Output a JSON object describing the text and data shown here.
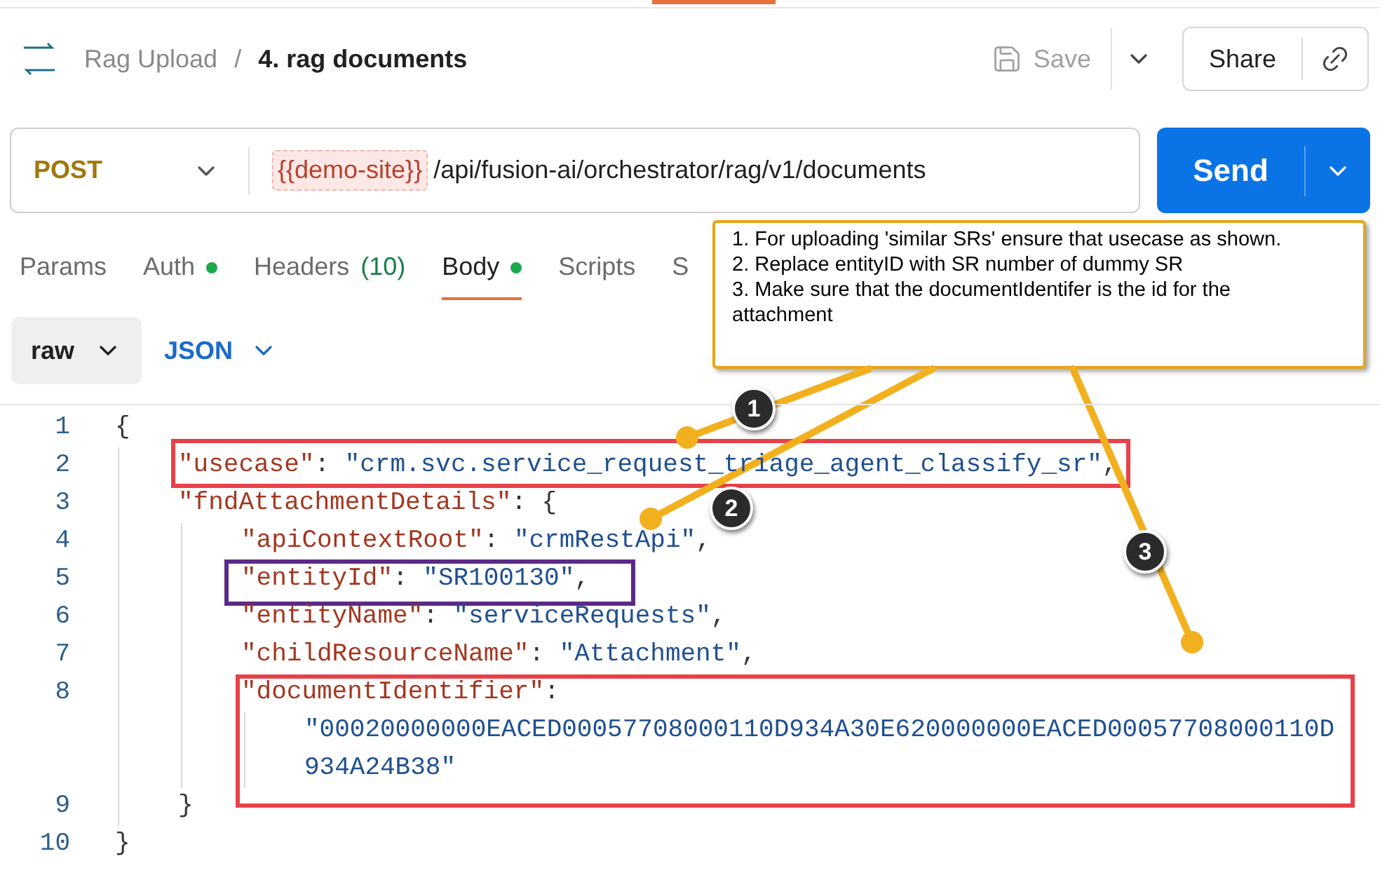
{
  "breadcrumb": {
    "collection": "Rag Upload",
    "separator": "/",
    "request": "4. rag documents"
  },
  "header_actions": {
    "save": "Save",
    "share": "Share"
  },
  "request": {
    "method": "POST",
    "url_variable": "{{demo-site}}",
    "url_path": "/api/fusion-ai/orchestrator/rag/v1/documents",
    "send": "Send"
  },
  "tabs": [
    {
      "label": "Params",
      "dot": false,
      "selected": false
    },
    {
      "label": "Auth",
      "dot": true,
      "selected": false
    },
    {
      "label": "Headers",
      "count": "(10)",
      "dot": false,
      "selected": false
    },
    {
      "label": "Body",
      "dot": true,
      "selected": true
    },
    {
      "label": "Scripts",
      "dot": false,
      "selected": false
    },
    {
      "label": "S",
      "dot": false,
      "selected": false
    }
  ],
  "body_mode": {
    "type": "raw",
    "format": "JSON"
  },
  "code_lines": [
    {
      "number": "1",
      "tokens": [
        {
          "kind": "punct",
          "text": "{"
        }
      ],
      "children": [
        {
          "number": "2",
          "tokens": [
            {
              "kind": "key",
              "text": "\"usecase\""
            },
            {
              "kind": "punct",
              "text": ": "
            },
            {
              "kind": "string",
              "text": "\"crm.svc.service_request_triage_agent_classify_sr\""
            },
            {
              "kind": "punct",
              "text": ","
            }
          ]
        },
        {
          "number": "3",
          "tokens": [
            {
              "kind": "key",
              "text": "\"fndAttachmentDetails\""
            },
            {
              "kind": "punct",
              "text": ": {"
            }
          ],
          "children": [
            {
              "number": "4",
              "tokens": [
                {
                  "kind": "key",
                  "text": "\"apiContextRoot\""
                },
                {
                  "kind": "punct",
                  "text": ": "
                },
                {
                  "kind": "string",
                  "text": "\"crmRestApi\""
                },
                {
                  "kind": "punct",
                  "text": ","
                }
              ]
            },
            {
              "number": "5",
              "tokens": [
                {
                  "kind": "key",
                  "text": "\"entityId\""
                },
                {
                  "kind": "punct",
                  "text": ": "
                },
                {
                  "kind": "string",
                  "text": "\"SR100130\""
                },
                {
                  "kind": "punct",
                  "text": ","
                }
              ]
            },
            {
              "number": "6",
              "tokens": [
                {
                  "kind": "key",
                  "text": "\"entityName\""
                },
                {
                  "kind": "punct",
                  "text": ": "
                },
                {
                  "kind": "string",
                  "text": "\"serviceRequests\""
                },
                {
                  "kind": "punct",
                  "text": ","
                }
              ]
            },
            {
              "number": "7",
              "tokens": [
                {
                  "kind": "key",
                  "text": "\"childResourceName\""
                },
                {
                  "kind": "punct",
                  "text": ": "
                },
                {
                  "kind": "string",
                  "text": "\"Attachment\""
                },
                {
                  "kind": "punct",
                  "text": ","
                }
              ]
            },
            {
              "number": "8",
              "tokens": [
                {
                  "kind": "key",
                  "text": "\"documentIdentifier\""
                },
                {
                  "kind": "punct",
                  "text": ":"
                }
              ],
              "children": [
                {
                  "tokens": [
                    {
                      "kind": "string",
                      "text": "\"00020000000EACED00057708000110D934A30E620000000EACED00057708000110D"
                    }
                  ]
                },
                {
                  "tokens": [
                    {
                      "kind": "string",
                      "text": "934A24B38\""
                    }
                  ]
                }
              ]
            }
          ]
        },
        {
          "number": "9",
          "tokens": [
            {
              "kind": "punct",
              "text": "}"
            }
          ]
        }
      ]
    },
    {
      "number": "10",
      "tokens": [
        {
          "kind": "punct",
          "text": "}"
        }
      ]
    }
  ],
  "annotations": {
    "callout": [
      "1. For uploading 'similar SRs' ensure that usecase as shown.",
      "2. Replace entityID with SR number of dummy SR",
      "3. Make sure that the documentIdentifer is the id for the attachment"
    ],
    "markers": [
      {
        "label": "1"
      },
      {
        "label": "2"
      },
      {
        "label": "3"
      }
    ],
    "highlights": [
      {
        "color": "#e8414a"
      },
      {
        "color": "#5b2a86"
      },
      {
        "color": "#e8414a"
      }
    ]
  }
}
